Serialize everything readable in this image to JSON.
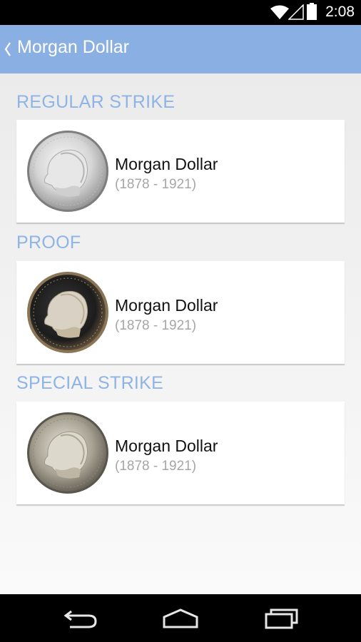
{
  "status": {
    "time": "2:08"
  },
  "action_bar": {
    "title": "Morgan Dollar"
  },
  "sections": [
    {
      "header": "REGULAR STRIKE",
      "item": {
        "name": "Morgan Dollar",
        "years": "(1878 - 1921)"
      }
    },
    {
      "header": "PROOF",
      "item": {
        "name": "Morgan Dollar",
        "years": "(1878 - 1921)"
      }
    },
    {
      "header": "SPECIAL STRIKE",
      "item": {
        "name": "Morgan Dollar",
        "years": "(1878 - 1921)"
      }
    }
  ],
  "icons": {
    "status": [
      "wifi-icon",
      "cell-signal-icon",
      "battery-icon"
    ],
    "action_bar": "back-chevron-icon",
    "nav": [
      "back-nav-icon",
      "home-nav-icon",
      "recent-apps-icon"
    ]
  },
  "colors": {
    "action_bar": "#8ab0e3",
    "section_header": "#8eb4e6",
    "status_bar": "#000000",
    "nav_bar": "#000000"
  }
}
